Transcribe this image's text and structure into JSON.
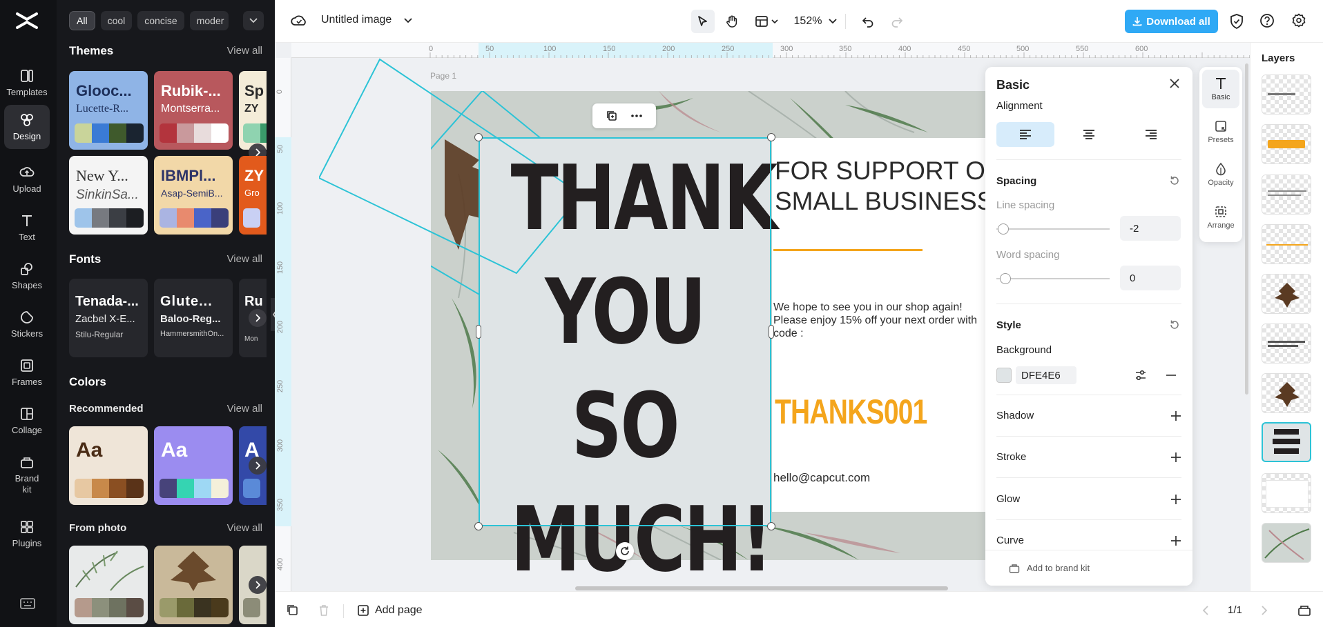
{
  "nav": {
    "items": [
      {
        "label": "Templates",
        "icon": "templates-icon"
      },
      {
        "label": "Design",
        "icon": "design-icon",
        "active": true
      },
      {
        "label": "Upload",
        "icon": "upload-icon"
      },
      {
        "label": "Text",
        "icon": "text-icon"
      },
      {
        "label": "Shapes",
        "icon": "shapes-icon"
      },
      {
        "label": "Stickers",
        "icon": "stickers-icon"
      },
      {
        "label": "Frames",
        "icon": "frames-icon"
      },
      {
        "label": "Collage",
        "icon": "collage-icon"
      },
      {
        "label": "Brand kit",
        "icon": "brand-kit-icon"
      },
      {
        "label": "Plugins",
        "icon": "plugins-icon"
      }
    ]
  },
  "panel": {
    "chips": [
      "All",
      "cool",
      "concise",
      "moder"
    ],
    "themes": {
      "title": "Themes",
      "view_all": "View all",
      "cards": [
        {
          "t1": "Glooc...",
          "t2": "Lucette-R...",
          "bg": "#8fb4e6",
          "fg": "#1d2f5a",
          "swatches": [
            "#c9d49a",
            "#3a7bd5",
            "#3f5a2c",
            "#1a2430"
          ]
        },
        {
          "t1": "Rubik-...",
          "t2": "Montserra...",
          "bg": "#b8585d",
          "fg": "#ffffff",
          "swatches": [
            "#b3343d",
            "#c9999c",
            "#e8dcdc",
            "#ffffff"
          ]
        },
        {
          "t1": "Sp",
          "t2": "ZY",
          "bg": "#f4ecd8",
          "fg": "#2b2b2b",
          "swatches": [
            "#8fd3b0",
            "#3a9a6a"
          ]
        },
        {
          "t1": "New Y...",
          "t2": "SinkinSa...",
          "bg": "#f4f4f4",
          "fg": "#333333",
          "swatches": [
            "#9ec4ea",
            "#777a80",
            "#3b3e44",
            "#1c1e22"
          ]
        },
        {
          "t1": "IBMPl...",
          "t2": "Asap-SemiB...",
          "bg": "#f2d8a8",
          "fg": "#2d3468",
          "swatches": [
            "#aab4e2",
            "#e88a6e",
            "#4a64c8",
            "#3a3f7a"
          ]
        },
        {
          "t1": "ZY",
          "t2": "Gro",
          "bg": "#e25a1c",
          "fg": "#ffffff",
          "swatches": [
            "#c9d0f4"
          ]
        }
      ]
    },
    "fonts": {
      "title": "Fonts",
      "view_all": "View all",
      "cards": [
        {
          "f1": "Tenada-...",
          "f2": "Zacbel X-E...",
          "f3": "Stilu-Regular"
        },
        {
          "f1": "Glute...",
          "f2": "Baloo-Reg...",
          "f3": "HammersmithOn..."
        },
        {
          "f1": "Ru",
          "f2": "",
          "f3": "Mon"
        }
      ]
    },
    "colors": {
      "title": "Colors",
      "recommended": "Recommended",
      "view_all": "View all",
      "cards": [
        {
          "aa": "Aa",
          "bg": "#efe5d8",
          "fg": "#4a2c16",
          "swatches": [
            "#e7c8a2",
            "#c8894a",
            "#8a4f22",
            "#5a3318"
          ]
        },
        {
          "aa": "Aa",
          "bg": "#9b8cf0",
          "fg": "#ffffff",
          "swatches": [
            "#47437a",
            "#35d4b2",
            "#9ed8f4",
            "#f4f0da"
          ]
        },
        {
          "aa": "A",
          "bg": "#3349a8",
          "fg": "#ffffff",
          "swatches": [
            "#5a8ad8"
          ]
        }
      ]
    },
    "from_photo": {
      "title": "From photo",
      "view_all": "View all",
      "cards": [
        {
          "bg": "#e8eaea",
          "swatches": [
            "#b59a8c",
            "#8c907c",
            "#6e7260",
            "#5a4c44"
          ]
        },
        {
          "bg": "#c9b99a",
          "swatches": [
            "#9a9a6a",
            "#6a6a3a",
            "#3a3320",
            "#4a3a1c"
          ]
        },
        {
          "bg": "#dad7c8",
          "swatches": [
            "#8c8c78"
          ]
        }
      ]
    }
  },
  "topbar": {
    "title": "Untitled image",
    "zoom": "152%",
    "download": "Download all"
  },
  "canvas": {
    "page_label": "Page 1",
    "ruler_h": [
      "0",
      "50",
      "100",
      "150",
      "200",
      "250",
      "300",
      "350",
      "400",
      "450",
      "500",
      "550",
      "600"
    ],
    "ruler_v": [
      "0",
      "50",
      "100",
      "150",
      "200",
      "250",
      "300",
      "350",
      "400"
    ],
    "design": {
      "headline": [
        "THANK",
        "YOU SO",
        "MUCH!"
      ],
      "support": [
        "FOR SUPPORT OUR",
        "SMALL BUSINESS"
      ],
      "hope": [
        "We hope to see you in our shop again!",
        "Please enjoy 15% off your next order with",
        "code :"
      ],
      "code": "THANKS001",
      "email": "hello@capcut.com"
    }
  },
  "props": {
    "title": "Basic",
    "alignment": "Alignment",
    "spacing": "Spacing",
    "line_spacing": {
      "label": "Line spacing",
      "value": "-2"
    },
    "word_spacing": {
      "label": "Word spacing",
      "value": "0"
    },
    "style": "Style",
    "background": {
      "label": "Background",
      "hex": "DFE4E6"
    },
    "rows": [
      "Shadow",
      "Stroke",
      "Glow",
      "Curve"
    ],
    "brand_kit": "Add to brand kit"
  },
  "tools": [
    {
      "label": "Basic",
      "icon": "text-t-icon",
      "active": true
    },
    {
      "label": "Presets",
      "icon": "presets-icon"
    },
    {
      "label": "Opacity",
      "icon": "opacity-icon"
    },
    {
      "label": "Arrange",
      "icon": "arrange-icon"
    }
  ],
  "layers": {
    "title": "Layers",
    "thumbs": [
      "text-small",
      "thanks001",
      "text-block",
      "line",
      "leaf",
      "support-text",
      "leaf",
      "thank-you",
      "white-card",
      "plants"
    ]
  },
  "bottombar": {
    "add_page": "Add page",
    "pages": "1/1"
  }
}
